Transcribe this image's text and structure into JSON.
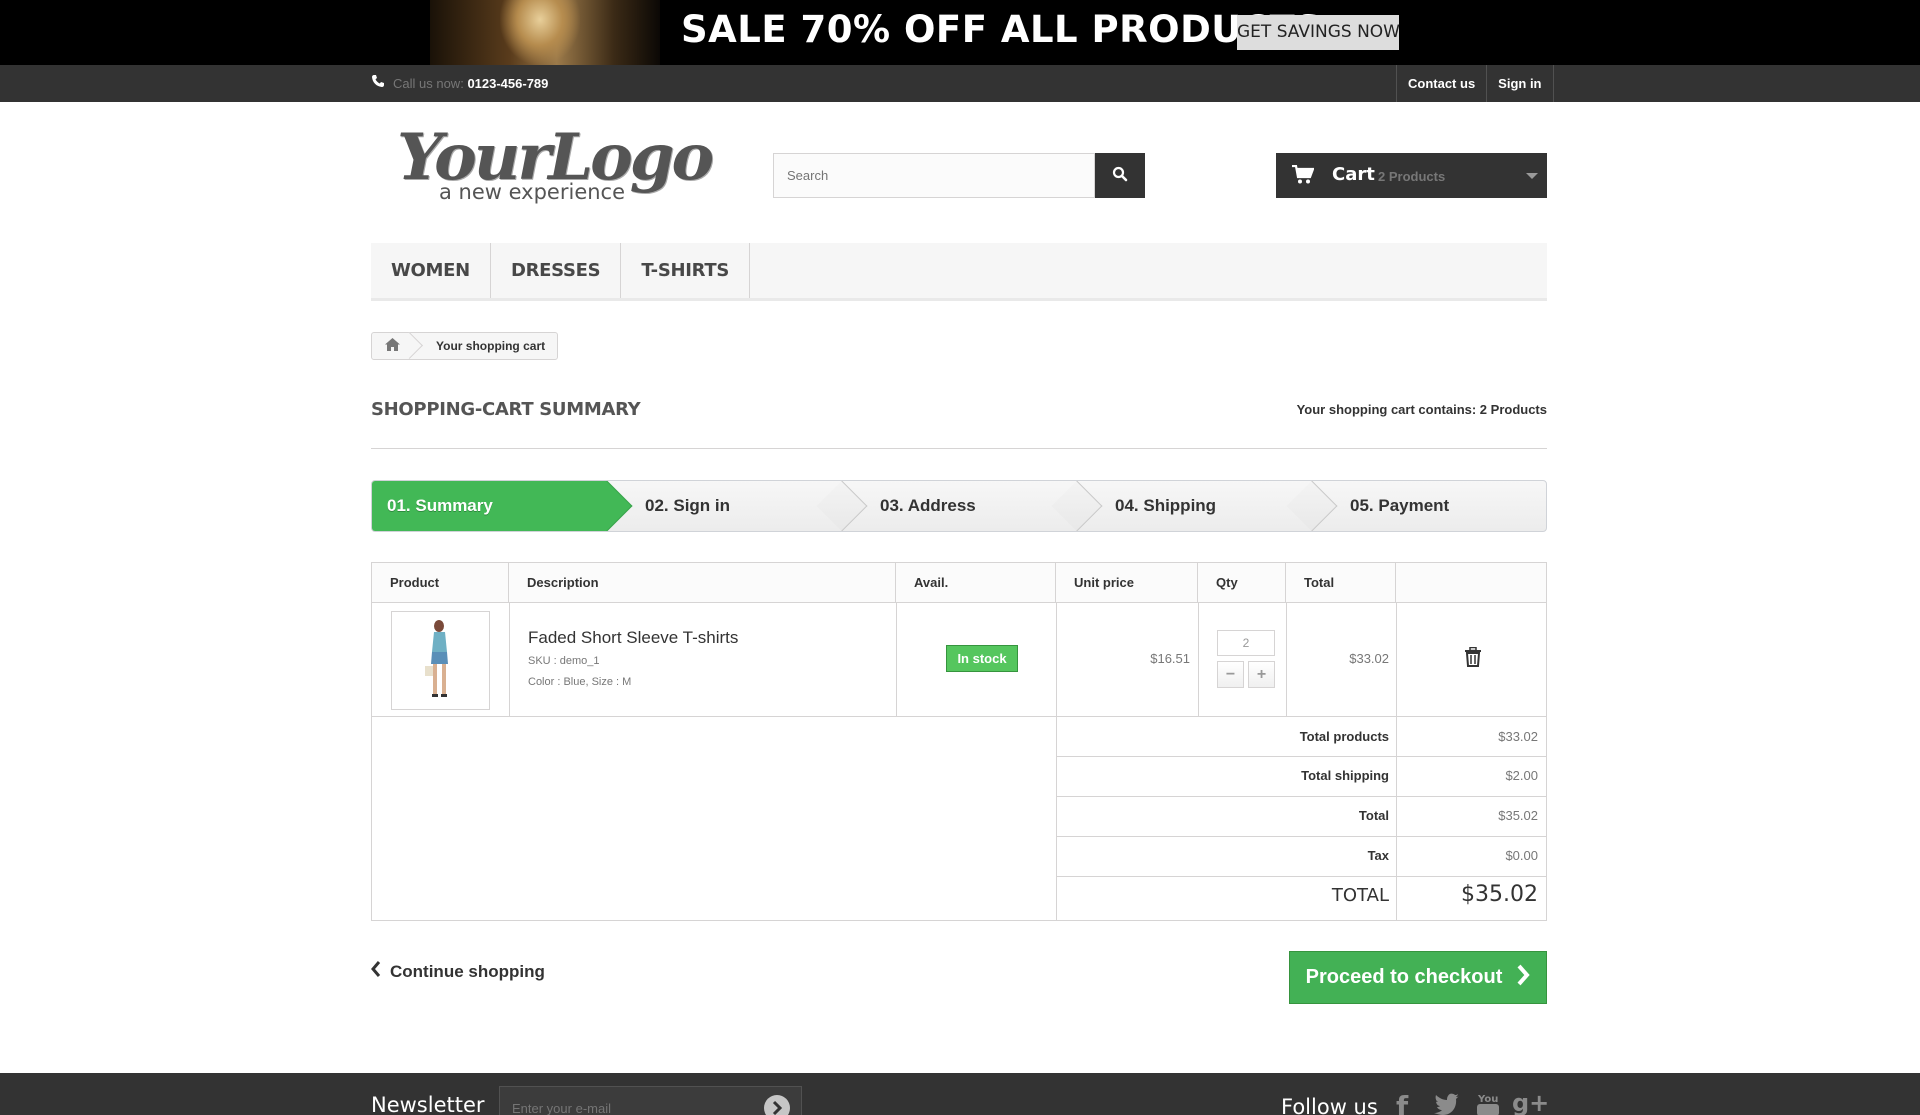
{
  "promo": {
    "text": "SALE 70% OFF ALL PRODUCTS",
    "button": "GET SAVINGS NOW"
  },
  "topbar": {
    "call_label": "Call us now:",
    "phone": "0123-456-789",
    "links": [
      "Contact us",
      "Sign in"
    ]
  },
  "logo": {
    "main": "YourLogo",
    "tagline": "a new experience"
  },
  "search": {
    "placeholder": "Search"
  },
  "cart": {
    "title": "Cart",
    "count": "2 Products"
  },
  "menu": [
    "WOMEN",
    "DRESSES",
    "T-SHIRTS"
  ],
  "breadcrumb": {
    "current": "Your shopping cart"
  },
  "page": {
    "heading": "SHOPPING-CART SUMMARY",
    "contains": "Your shopping cart contains: 2 Products"
  },
  "steps": [
    "01. Summary",
    "02. Sign in",
    "03. Address",
    "04. Shipping",
    "05. Payment"
  ],
  "table": {
    "headers": [
      "Product",
      "Description",
      "Avail.",
      "Unit price",
      "Qty",
      "Total"
    ],
    "item": {
      "name": "Faded Short Sleeve T-shirts",
      "sku": "SKU : demo_1",
      "attributes": "Color : Blue, Size : M",
      "availability": "In stock",
      "unit_price": "$16.51",
      "qty": "2",
      "total": "$33.02"
    },
    "summary": [
      {
        "label": "Total products",
        "value": "$33.02"
      },
      {
        "label": "Total shipping",
        "value": "$2.00"
      },
      {
        "label": "Total",
        "value": "$35.02"
      },
      {
        "label": "Tax",
        "value": "$0.00"
      }
    ],
    "grand_total": {
      "label": "TOTAL",
      "value": "$35.02"
    }
  },
  "actions": {
    "continue": "Continue shopping",
    "checkout": "Proceed to checkout"
  },
  "footer": {
    "newsletter_title": "Newsletter",
    "newsletter_placeholder": "Enter your e-mail",
    "follow_title": "Follow us"
  },
  "colors": {
    "accent_green": "#43b155",
    "dark_bar": "#333333"
  }
}
